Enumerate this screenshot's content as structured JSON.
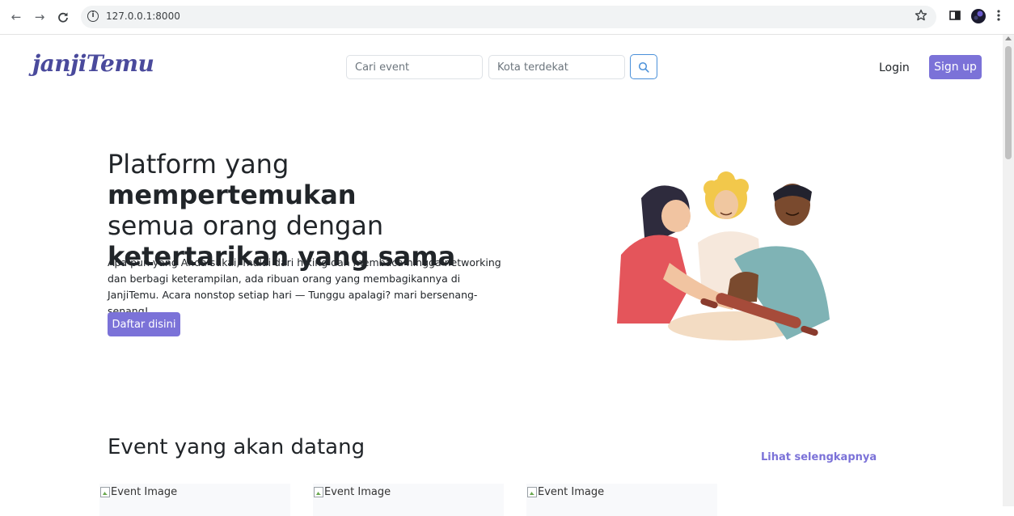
{
  "browser": {
    "url": "127.0.0.1:8000",
    "back_icon": "back-arrow-icon",
    "forward_icon": "forward-arrow-icon",
    "reload_icon": "reload-icon",
    "site_info_icon": "info-icon"
  },
  "header": {
    "logo": "janjiTemu",
    "search_event_placeholder": "Cari event",
    "search_city_placeholder": "Kota terdekat",
    "login_label": "Login",
    "signup_label": "Sign up"
  },
  "hero": {
    "title_part1": "Platform yang ",
    "title_bold1": "mempertemukan",
    "title_part2": "semua orang dengan",
    "title_bold2": "ketertarikan yang sama",
    "description": "Apa pun yang Anda sukai, mulai dari hiking dan membaca hingga networking dan berbagi keterampilan, ada ribuan orang yang membagikannya di JanjiTemu. Acara nonstop setiap hari — Tunggu apalagi? mari bersenang-senang!",
    "cta_label": "Daftar disini"
  },
  "events": {
    "section_title": "Event yang akan datang",
    "see_more_label": "Lihat selengkapnya",
    "cards": [
      {
        "image_alt": "Event Image"
      },
      {
        "image_alt": "Event Image"
      },
      {
        "image_alt": "Event Image"
      }
    ]
  },
  "colors": {
    "accent": "#7b72d8",
    "logo": "#4a4a9c",
    "search_button_border": "#4a90d9"
  }
}
